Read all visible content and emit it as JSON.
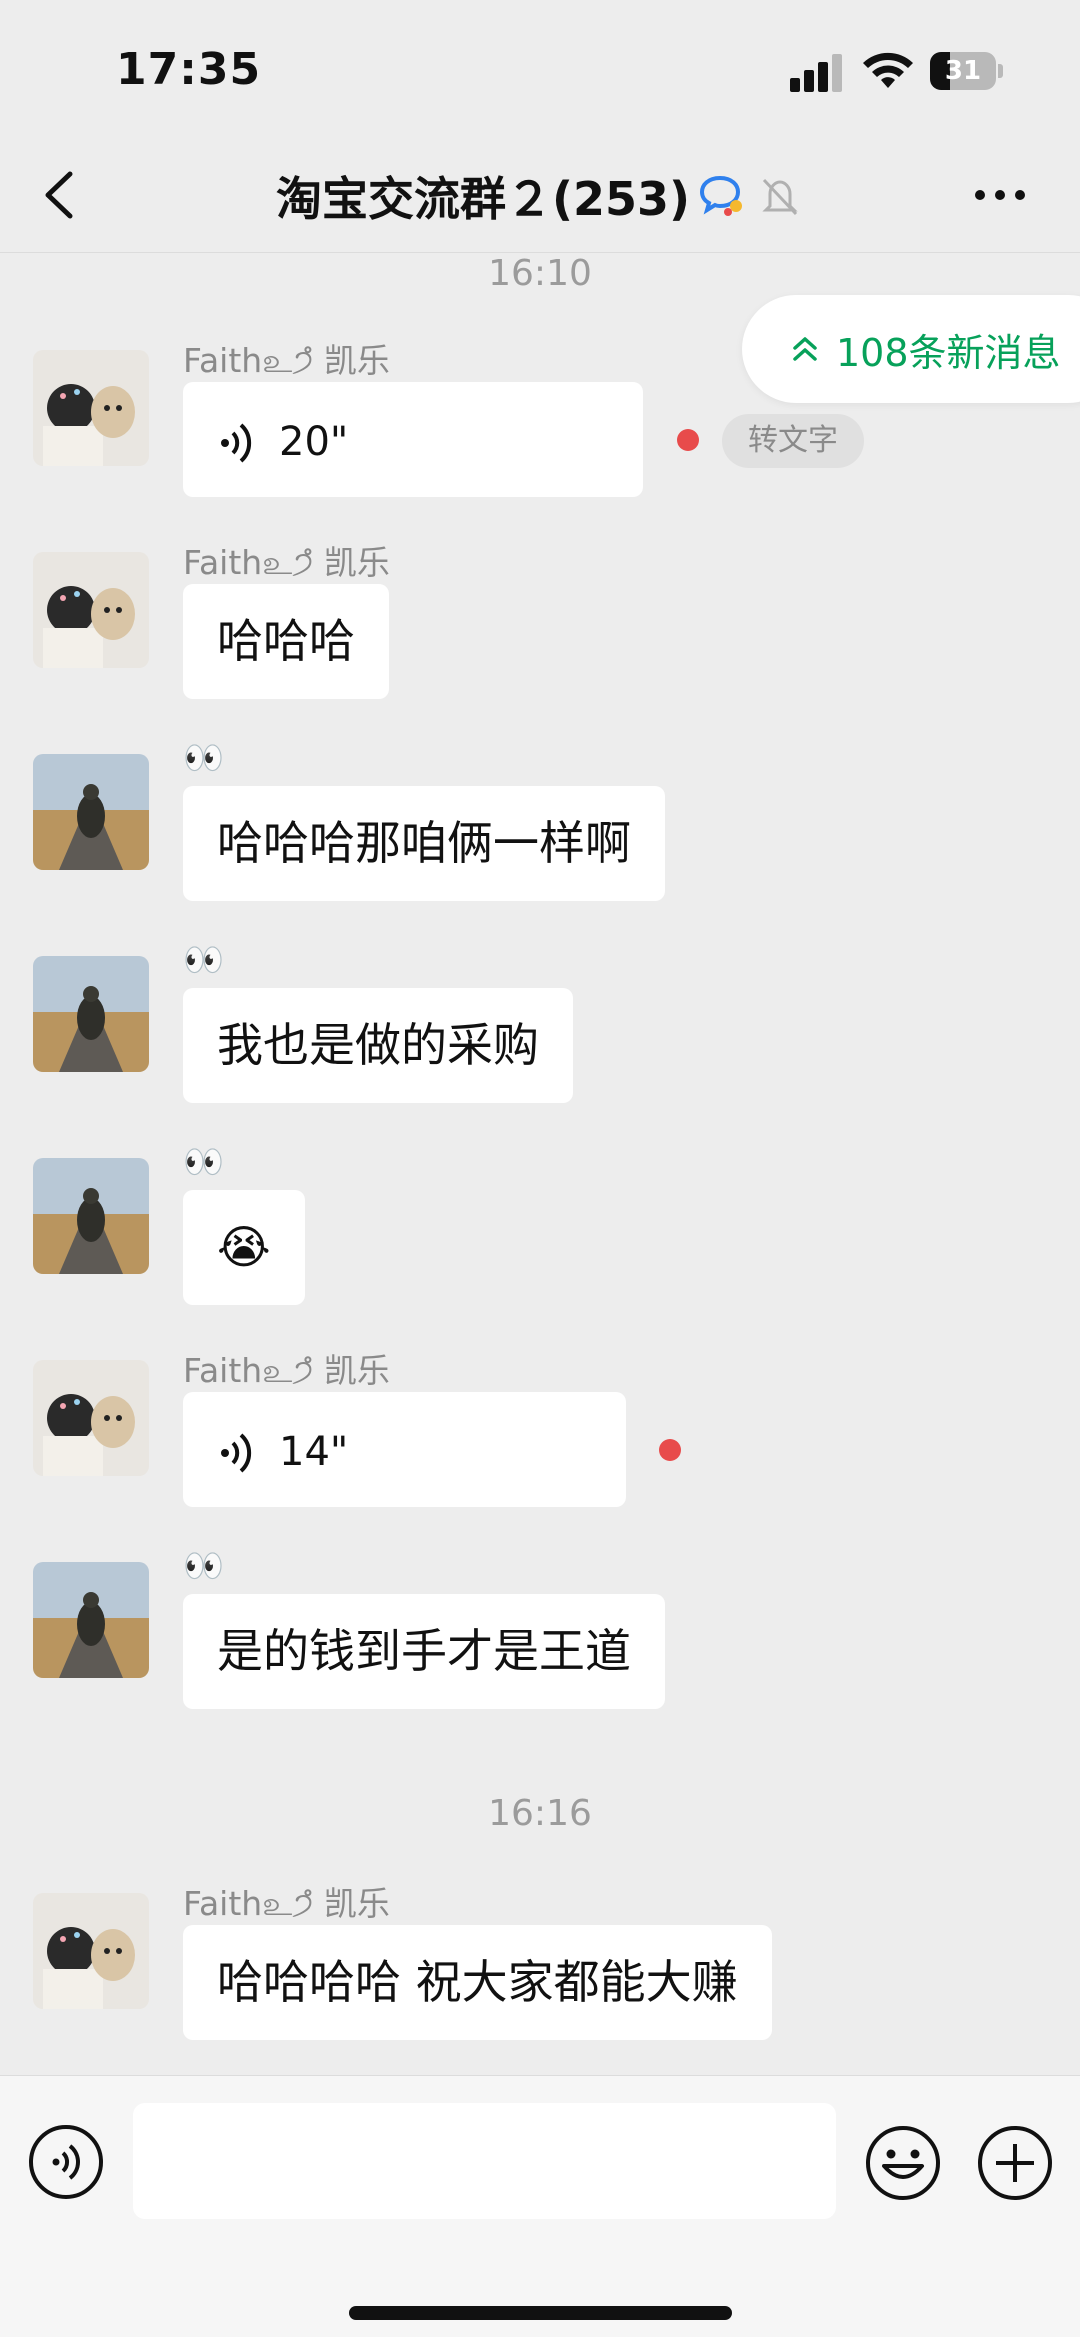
{
  "status_bar": {
    "time": "17:35",
    "battery": "31",
    "battery_level": 0.31
  },
  "header": {
    "back": "back-arrow-icon",
    "title": "淘宝交流群２(253)",
    "more": "more-dots-icon"
  },
  "new_messages": {
    "text": "108条新消息"
  },
  "messages": [
    {
      "type": "timestamp",
      "text": "16:10"
    },
    {
      "type": "voice",
      "sender": "Faithஉ੭̊ 凯乐",
      "duration": "20\"",
      "unread": true,
      "to_text": "转文字",
      "avatar": "girl-with-dog"
    },
    {
      "type": "text",
      "sender": "Faithஉ੭̊ 凯乐",
      "text": "哈哈哈",
      "avatar": "girl-with-dog"
    },
    {
      "type": "text",
      "sender": "👀",
      "text": "哈哈哈那咱俩一样啊",
      "avatar": "man-on-road"
    },
    {
      "type": "text",
      "sender": "👀",
      "text": "我也是做的采购",
      "avatar": "man-on-road"
    },
    {
      "type": "emoji",
      "sender": "👀",
      "text": "😭",
      "avatar": "man-on-road"
    },
    {
      "type": "voice",
      "sender": "Faithஉ੭̊ 凯乐",
      "duration": "14\"",
      "unread": true,
      "avatar": "girl-with-dog"
    },
    {
      "type": "text",
      "sender": "👀",
      "text": "是的钱到手才是王道",
      "avatar": "man-on-road"
    },
    {
      "type": "timestamp",
      "text": "16:16"
    },
    {
      "type": "text",
      "sender": "Faithஉ੭̊ 凯乐",
      "text": "哈哈哈哈 祝大家都能大赚",
      "avatar": "girl-with-dog"
    }
  ],
  "input_bar": {
    "voice": "voice-mode-icon",
    "placeholder": "",
    "emoji": "emoji-icon",
    "plus": "plus-icon"
  },
  "colors": {
    "accent": "#07a15a",
    "unread": "#e84b4b",
    "background": "#ededed"
  }
}
